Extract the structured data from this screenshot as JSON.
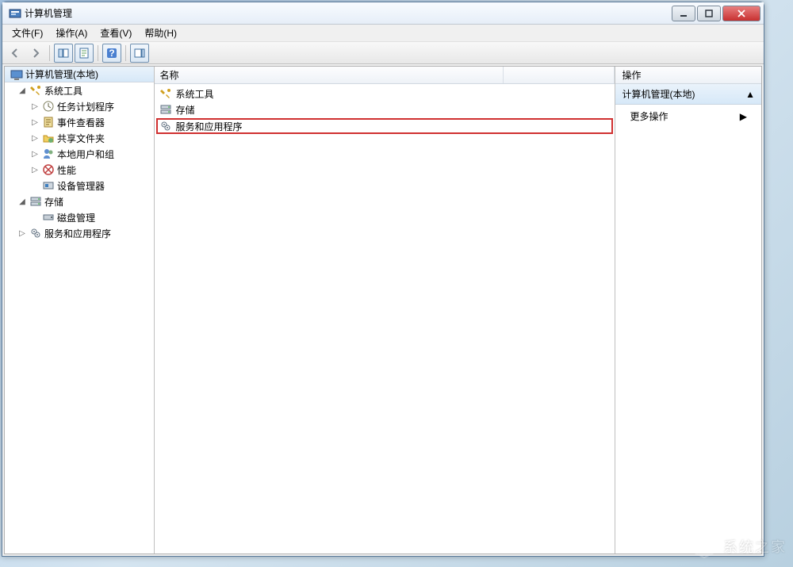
{
  "window": {
    "title": "计算机管理"
  },
  "menubar": {
    "file": "文件(F)",
    "action": "操作(A)",
    "view": "查看(V)",
    "help": "帮助(H)"
  },
  "tree": {
    "root": "计算机管理(本地)",
    "system_tools": "系统工具",
    "task_scheduler": "任务计划程序",
    "event_viewer": "事件查看器",
    "shared_folders": "共享文件夹",
    "local_users": "本地用户和组",
    "performance": "性能",
    "device_manager": "设备管理器",
    "storage": "存储",
    "disk_management": "磁盘管理",
    "services_apps": "服务和应用程序"
  },
  "list": {
    "header_name": "名称",
    "items": {
      "system_tools": "系统工具",
      "storage": "存储",
      "services_apps": "服务和应用程序"
    }
  },
  "actions": {
    "header": "操作",
    "section_title": "计算机管理(本地)",
    "more_actions": "更多操作"
  },
  "watermark": "系统之家"
}
